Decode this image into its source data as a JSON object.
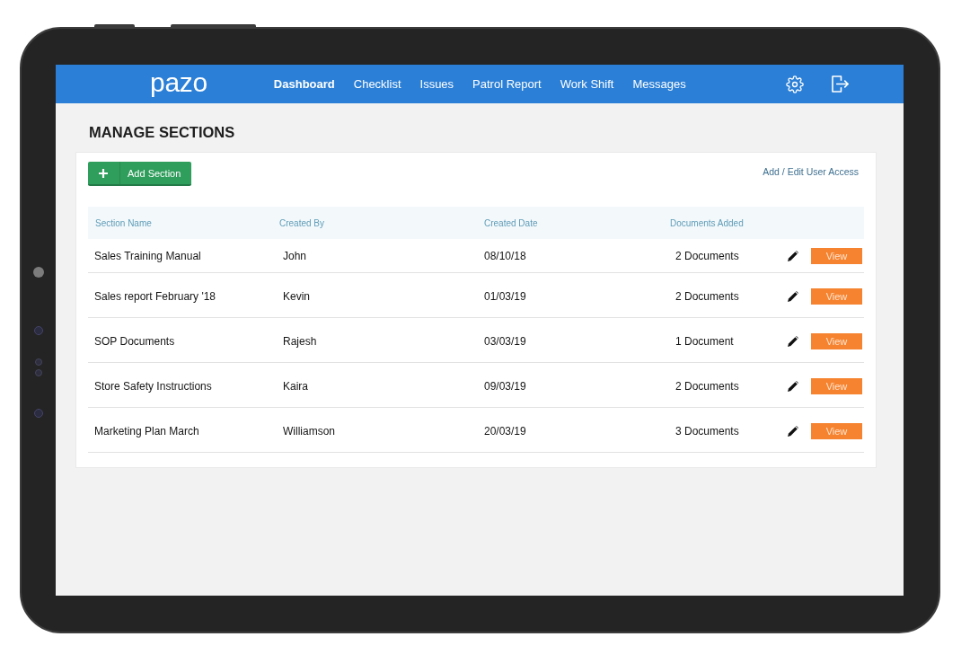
{
  "nav": {
    "logo": "pazo",
    "links": [
      {
        "label": "Dashboard",
        "selected": true
      },
      {
        "label": "Checklist",
        "selected": false
      },
      {
        "label": "Issues",
        "selected": false
      },
      {
        "label": "Patrol Report",
        "selected": false
      },
      {
        "label": "Work Shift",
        "selected": false
      },
      {
        "label": "Messages",
        "selected": false
      }
    ]
  },
  "page": {
    "title": "MANAGE SECTIONS"
  },
  "toolbar": {
    "add_button": "Add Section",
    "access_link": "Add / Edit User Access"
  },
  "table": {
    "columns": [
      "Section Name",
      "Created By",
      "Created Date",
      "Documents Added"
    ],
    "rows": [
      {
        "section_name": "Sales Training Manual",
        "created_by": "John",
        "created_date": "08/10/18",
        "documents_added": "2 Documents",
        "action": "View"
      },
      {
        "section_name": "Sales report February '18",
        "created_by": "Kevin",
        "created_date": "01/03/19",
        "documents_added": "2 Documents",
        "action": "View"
      },
      {
        "section_name": "SOP Documents",
        "created_by": "Rajesh",
        "created_date": "03/03/19",
        "documents_added": "1 Document",
        "action": "View"
      },
      {
        "section_name": "Store Safety Instructions",
        "created_by": "Kaira",
        "created_date": "09/03/19",
        "documents_added": "2 Documents",
        "action": "View"
      },
      {
        "section_name": "Marketing Plan March",
        "created_by": "Williamson",
        "created_date": "20/03/19",
        "documents_added": "3 Documents",
        "action": "View"
      }
    ]
  }
}
